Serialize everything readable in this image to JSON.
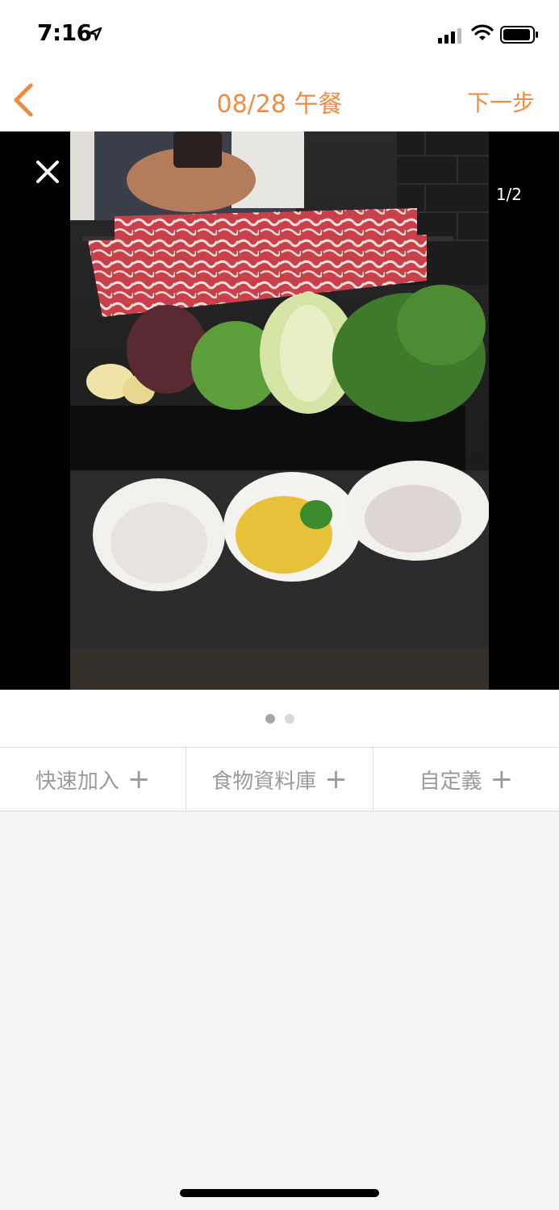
{
  "status_bar": {
    "time": "7:16",
    "icons": [
      "location-arrow-icon",
      "cellular-signal-icon",
      "wifi-icon",
      "battery-icon"
    ]
  },
  "nav": {
    "title": "08/28 午餐",
    "next_label": "下一步",
    "accent_color": "#f08c42",
    "back_icon": "chevron-left-icon"
  },
  "photo_viewer": {
    "counter": "1/2",
    "close_icon": "close-icon",
    "total_pages": 2,
    "current_page": 1
  },
  "tabs": [
    {
      "label": "快速加入",
      "icon": "plus-icon"
    },
    {
      "label": "食物資料庫",
      "icon": "plus-icon"
    },
    {
      "label": "自定義",
      "icon": "plus-icon"
    }
  ]
}
